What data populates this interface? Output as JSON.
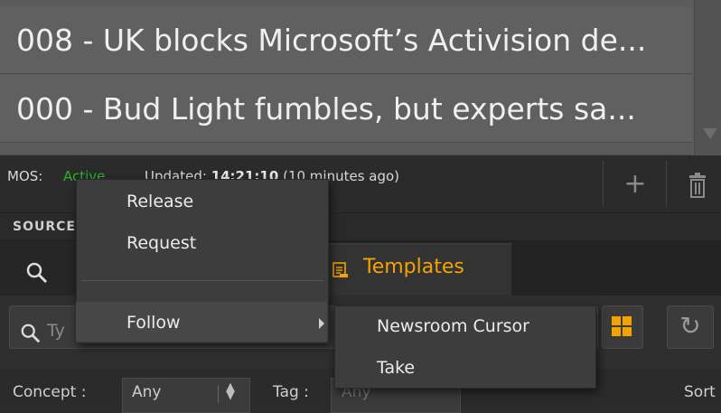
{
  "rundown": {
    "items": [
      {
        "label": "008 - UK blocks Microsoft’s Activision de..."
      },
      {
        "label": "000 - Bud Light fumbles, but experts sa..."
      }
    ]
  },
  "status": {
    "mos_label": "MOS:",
    "mos_value": "Active",
    "mos_color": "#29b32e",
    "updated_prefix": "Updated:",
    "updated_time": "14:21:10",
    "updated_ago": "(10 minutes ago)"
  },
  "toolbar": {
    "add_icon": "plus-icon",
    "trash_icon": "trash-icon"
  },
  "source": {
    "header": "SOURCE"
  },
  "tabs": {
    "search_icon": "search-icon",
    "templates_label": "Templates",
    "templates_icon": "templates-icon",
    "accent_color": "#f4a300"
  },
  "filter": {
    "search_placeholder": "Ty",
    "grid_icon": "grid-icon",
    "refresh_icon": "refresh-icon"
  },
  "filters": {
    "concept_label": "Concept :",
    "concept_value": "Any",
    "tag_label": "Tag :",
    "tag_value": "Any",
    "sort_label": "Sort"
  },
  "context_menu": {
    "items": [
      {
        "label": "Release"
      },
      {
        "label": "Request"
      },
      {
        "label": "Follow"
      }
    ],
    "submenu": [
      {
        "label": "Newsroom Cursor"
      },
      {
        "label": "Take"
      }
    ]
  }
}
